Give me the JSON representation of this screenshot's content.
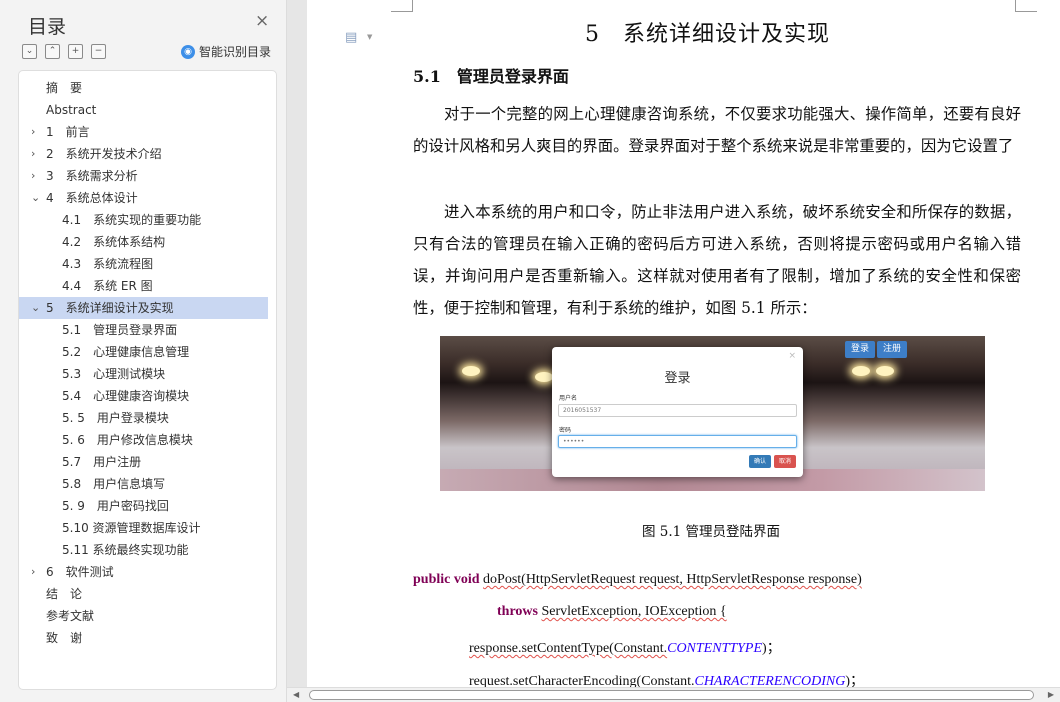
{
  "toc": {
    "title": "目录",
    "smart_label": "智能识别目录",
    "items": [
      {
        "text": "摘　要",
        "level": 0,
        "arrow": ""
      },
      {
        "text": "Abstract",
        "level": 0,
        "arrow": ""
      },
      {
        "text": "1　前言",
        "level": 0,
        "arrow": "›"
      },
      {
        "text": "2　系统开发技术介绍",
        "level": 0,
        "arrow": "›"
      },
      {
        "text": "3　系统需求分析",
        "level": 0,
        "arrow": "›"
      },
      {
        "text": "4　系统总体设计",
        "level": 0,
        "arrow": "⌄"
      },
      {
        "text": "4.1　系统实现的重要功能",
        "level": 1,
        "arrow": ""
      },
      {
        "text": "4.2　系统体系结构",
        "level": 1,
        "arrow": ""
      },
      {
        "text": "4.3　系统流程图",
        "level": 1,
        "arrow": ""
      },
      {
        "text": "4.4　系统 ER 图",
        "level": 1,
        "arrow": ""
      },
      {
        "text": "5　系统详细设计及实现",
        "level": 0,
        "arrow": "⌄",
        "active": true
      },
      {
        "text": "5.1　管理员登录界面",
        "level": 1,
        "arrow": ""
      },
      {
        "text": "5.2　心理健康信息管理",
        "level": 1,
        "arrow": ""
      },
      {
        "text": "5.3　心理测试模块",
        "level": 1,
        "arrow": ""
      },
      {
        "text": "5.4　心理健康咨询模块",
        "level": 1,
        "arrow": ""
      },
      {
        "text": "5. 5　用户登录模块",
        "level": 1,
        "arrow": ""
      },
      {
        "text": "5. 6　用户修改信息模块",
        "level": 1,
        "arrow": ""
      },
      {
        "text": "5.7　用户注册",
        "level": 1,
        "arrow": ""
      },
      {
        "text": "5.8　用户信息填写",
        "level": 1,
        "arrow": ""
      },
      {
        "text": "5. 9　用户密码找回",
        "level": 1,
        "arrow": ""
      },
      {
        "text": "5.10  资源管理数据库设计",
        "level": 1,
        "arrow": ""
      },
      {
        "text": "5.11  系统最终实现功能",
        "level": 1,
        "arrow": ""
      },
      {
        "text": "6　软件测试",
        "level": 0,
        "arrow": "›"
      },
      {
        "text": "结　论",
        "level": 0,
        "arrow": ""
      },
      {
        "text": "参考文献",
        "level": 0,
        "arrow": ""
      },
      {
        "text": "致　谢",
        "level": 0,
        "arrow": ""
      }
    ]
  },
  "document": {
    "chapter_heading": "5　系统详细设计及实现",
    "section_heading": "5.1　管理员登录界面",
    "paragraph1": "对于一个完整的网上心理健康咨询系统，不仅要求功能强大、操作简单，还要有良好的设计风格和另人爽目的界面。登录界面对于整个系统来说是非常重要的，因为它设置了",
    "paragraph2": "进入本系统的用户和口令，防止非法用户进入系统，破坏系统安全和所保存的数据，只有合法的管理员在输入正确的密码后方可进入系统，否则将提示密码或用户名输入错误，并询问用户是否重新输入。这样就对使用者有了限制，增加了系统的安全性和保密性，便于控制和管理，有利于系统的维护，如图 5.1 所示：",
    "figure": {
      "top_buttons": [
        "登录",
        "注册"
      ],
      "modal_title": "登录",
      "username_label": "用户名",
      "username_value": "2016051537",
      "password_label": "密码",
      "password_value": "••••••",
      "ok_label": "确认",
      "cancel_label": "取消"
    },
    "caption": "图 5.1 管理员登陆界面",
    "code": {
      "line1_kw": "public void",
      "line1_rest": "doPost(HttpServletRequest request, HttpServletResponse response)",
      "line2_kw": "throws",
      "line2_rest": "ServletException, IOException {",
      "line3_a": "response.setContentType(Constant.",
      "line3_it": "CONTENTTYPE",
      "line3_b": ")；",
      "line4_a": "request.setCharacterEncoding(Constant.",
      "line4_it": "CHARACTERENCODING",
      "line4_b": ")；"
    }
  },
  "colors": {
    "active_item": "#c9d7f2",
    "keyword": "#7f0055",
    "constant": "#2a00ff"
  }
}
